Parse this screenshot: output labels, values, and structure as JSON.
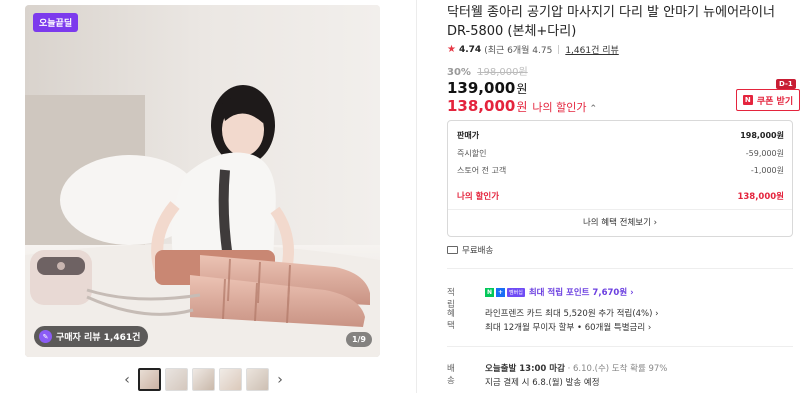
{
  "gallery": {
    "badge": "오늘끝딜",
    "review_badge": "구매자 리뷰 1,461건",
    "pager": "1/9",
    "prev_icon": "chevron-left-icon",
    "next_icon": "chevron-right-icon",
    "prev": "‹",
    "next": "›"
  },
  "product": {
    "title": "닥터웰 종아리 공기압 마사지기 다리 발 안마기 뉴에어라이너 DR-5800 (본체+다리)",
    "rating_score": "4.74",
    "rating_detail": "(최근 6개월 4.75",
    "review_link": "1,461건 리뷰",
    "discount_pct": "30%",
    "original_price": "198,000원",
    "price": "139,000",
    "won": "원",
    "my_price": "138,000",
    "my_price_label": "나의 할인가",
    "coupon_label": "쿠폰 받기",
    "dday": "D-1"
  },
  "price_box": {
    "rows": [
      {
        "label": "판매가",
        "value": "198,000원"
      },
      {
        "label": "즉시할인",
        "value": "-59,000원"
      },
      {
        "label": "스토어 전 고객",
        "value": "-1,000원"
      }
    ],
    "final_label": "나의 할인가",
    "final_value": "138,000원",
    "benefit_link": "나의 혜택 전체보기 ›"
  },
  "shipping_free": "무료배송",
  "details": {
    "points_key": "적립",
    "points_value": "최대 적립 포인트 7,670원 ›",
    "benefit_key": "혜택",
    "benefit_line1": "라인프렌즈 카드 최대 5,520원 추가 적립(4%) ›",
    "benefit_line2": "최대 12개월 무이자 할부 • 60개월 특별금리 ›",
    "delivery_key": "배송",
    "delivery_bold": "오늘출발 13:00 마감",
    "delivery_rest": "· 6.10.(수) 도착 확률 97%",
    "delivery_line2": "지금 결제 시 6.8.(월) 발송 예정"
  },
  "colors": {
    "accent_red": "#e4243d",
    "purple": "#7c3aed",
    "naver_green": "#03c75a"
  }
}
